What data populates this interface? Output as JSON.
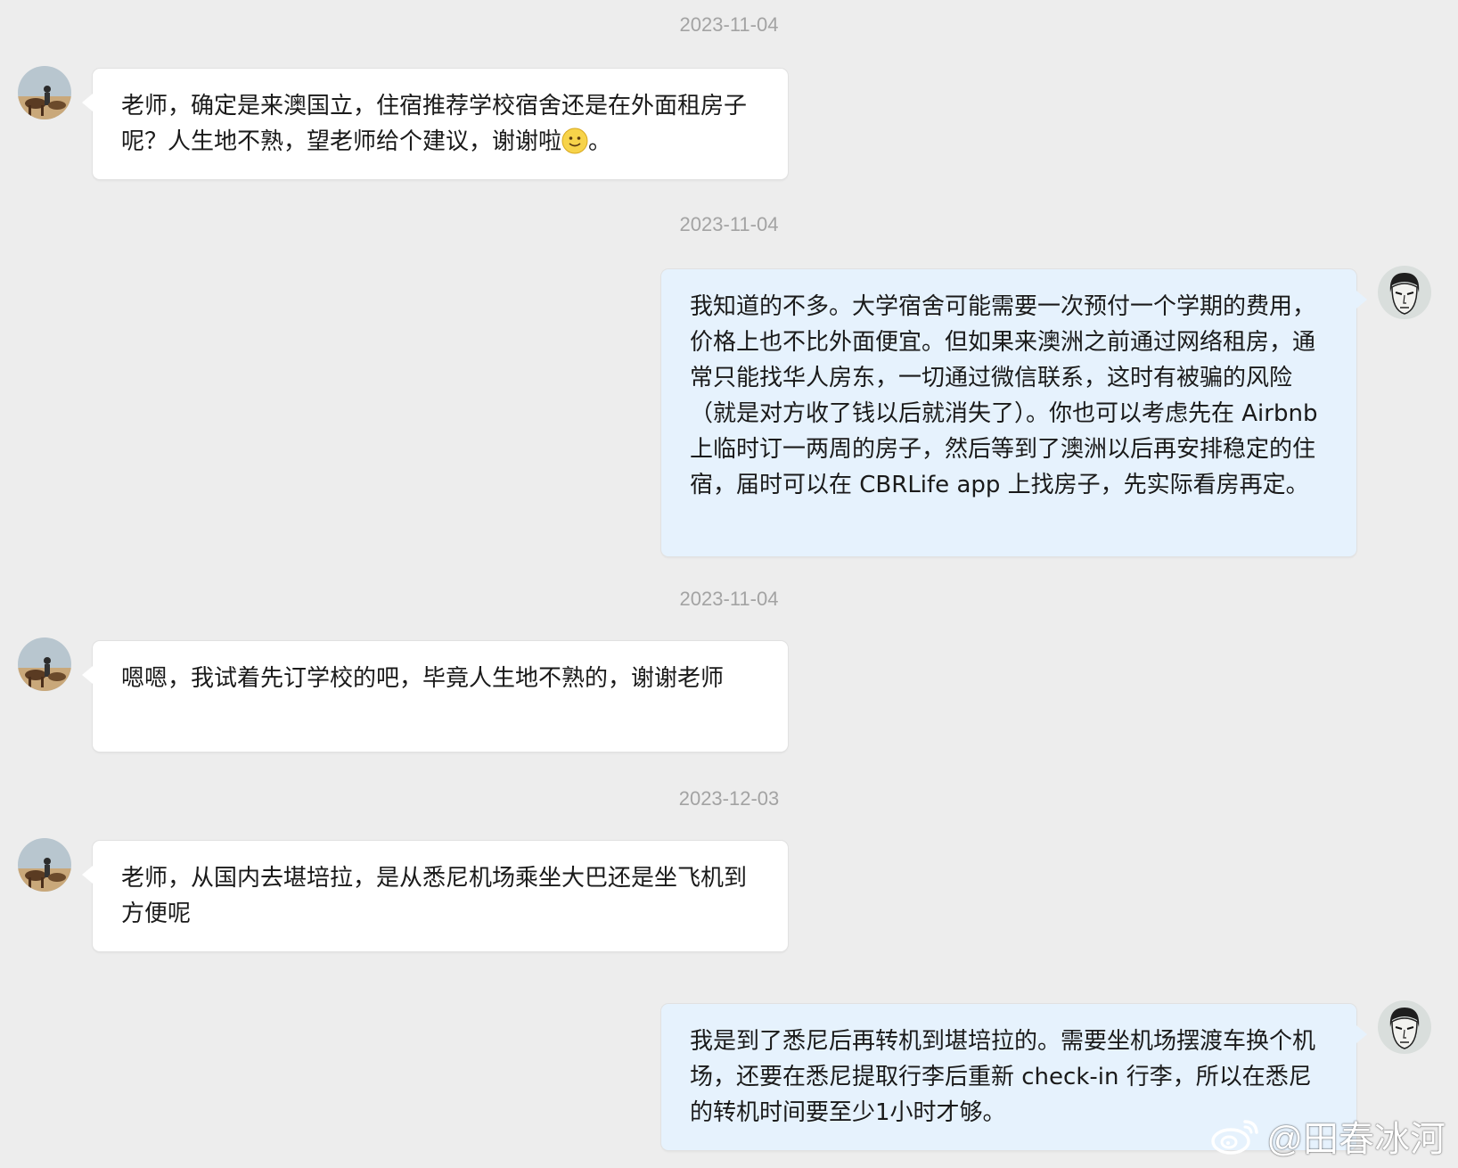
{
  "messages": [
    {
      "time": "2023-11-04",
      "text": "老师，确定是来澳国立，住宿推荐学校宿舍还是在外面租房子呢？人生地不熟，望老师给个建议，谢谢啦",
      "suffix": "。",
      "emoji": "smiley-emoji"
    },
    {
      "time": "2023-11-04",
      "text": "我知道的不多。大学宿舍可能需要一次预付一个学期的费用，价格上也不比外面便宜。但如果来澳洲之前通过网络租房，通常只能找华人房东，一切通过微信联系，这时有被骗的风险（就是对方收了钱以后就消失了）。你也可以考虑先在 Airbnb 上临时订一两周的房子，然后等到了澳洲以后再安排稳定的住宿，届时可以在 CBRLife app 上找房子，先实际看房再定。"
    },
    {
      "time": "2023-11-04",
      "text": "嗯嗯，我试着先订学校的吧，毕竟人生地不熟的，谢谢老师"
    },
    {
      "time": "2023-12-03",
      "text": "老师，从国内去堪培拉，是从悉尼机场乘坐大巴还是坐飞机到方便呢"
    },
    {
      "text": "我是到了悉尼后再转机到堪培拉的。需要坐机场摆渡车换个机场，还要在悉尼提取行李后重新 check-in 行李，所以在悉尼的转机时间要至少1小时才够。"
    }
  ],
  "watermark": {
    "text": "@田春冰河",
    "icon": "weibo-icon"
  },
  "colors": {
    "background": "#ededed",
    "left_bubble": "#ffffff",
    "right_bubble": "#e6f2fd",
    "timestamp": "#a3a3a3"
  }
}
